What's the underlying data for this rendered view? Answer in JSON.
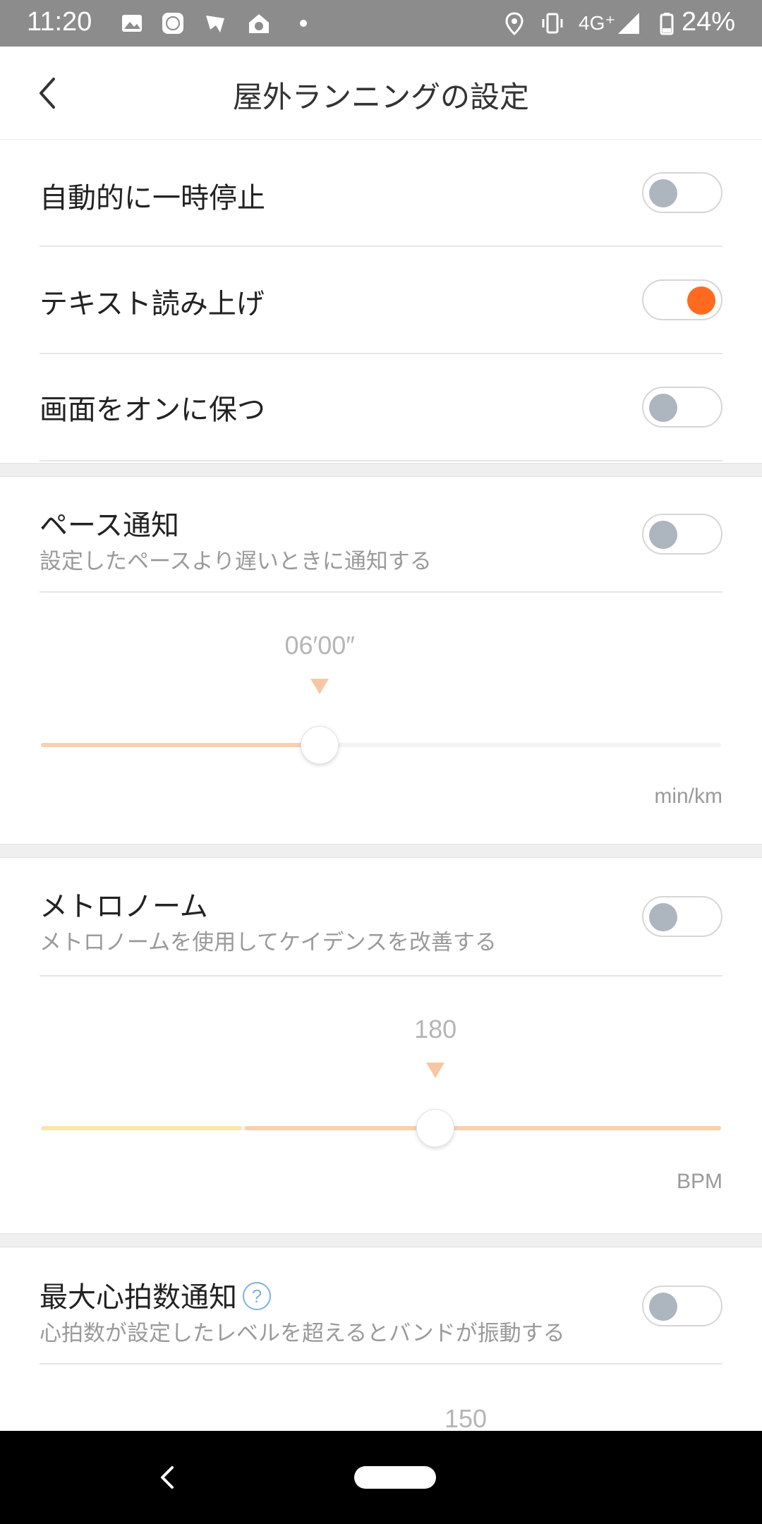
{
  "status_bar": {
    "time": "11:20",
    "network": "4G⁺",
    "battery": "24%"
  },
  "header": {
    "title": "屋外ランニングの設定"
  },
  "settings": {
    "auto_pause": {
      "label": "自動的に一時停止",
      "enabled": false
    },
    "voice": {
      "label": "テキスト読み上げ",
      "enabled": true
    },
    "keep_screen": {
      "label": "画面をオンに保つ",
      "enabled": false
    }
  },
  "pace_alert": {
    "label": "ペース通知",
    "description": "設定したペースより遅いときに通知する",
    "enabled": false,
    "value": "06′00″",
    "position_fraction": 0.41,
    "unit": "min/km"
  },
  "metronome": {
    "label": "メトロノーム",
    "description": "メトロノームを使用してケイデンスを改善する",
    "enabled": false,
    "value": "180",
    "position_fraction": 0.58,
    "unit": "BPM"
  },
  "max_hr_alert": {
    "label": "最大心拍数通知",
    "help": "?",
    "description": "心拍数が設定したレベルを超えるとバンドが振動する",
    "enabled": false,
    "value": "150"
  },
  "colors": {
    "accent": "#ff6a1f",
    "slider_fill": "#f9cfae",
    "slider_fill_light": "#fbe6a8",
    "toggle_off_knob": "#adb5bf",
    "status_bar": "#8c8c8c"
  }
}
